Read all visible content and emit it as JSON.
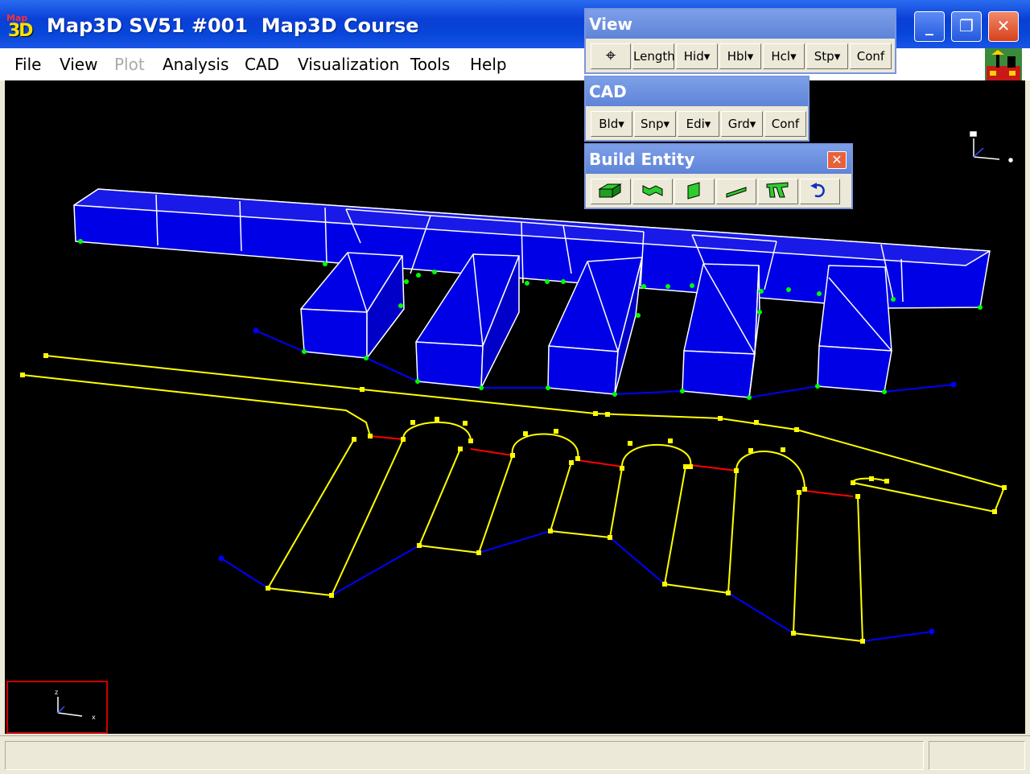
{
  "window": {
    "title": "Map3D SV51 #001  Map3D Course",
    "logo_top": "Map",
    "logo_bottom": "3D",
    "minimize_glyph": "_",
    "restore_glyph": "❐",
    "close_glyph": "✕"
  },
  "menubar": {
    "items": [
      {
        "label": "File",
        "enabled": true
      },
      {
        "label": "View",
        "enabled": true
      },
      {
        "label": "Plot",
        "enabled": false
      },
      {
        "label": "Analysis",
        "enabled": true
      },
      {
        "label": "CAD",
        "enabled": true
      },
      {
        "label": "Visualization",
        "enabled": true
      },
      {
        "label": "Tools",
        "enabled": true
      },
      {
        "label": "Help",
        "enabled": true
      }
    ]
  },
  "palettes": {
    "view": {
      "title": "View",
      "buttons": [
        "⌖",
        "Length",
        "Hid▾",
        "Hbl▾",
        "Hcl▾",
        "Stp▾",
        "Conf"
      ]
    },
    "cad": {
      "title": "CAD",
      "buttons": [
        "Bld▾",
        "Snp▾",
        "Edi▾",
        "Grd▾",
        "Conf"
      ]
    },
    "build_entity": {
      "title": "Build Entity",
      "close_glyph": "✕",
      "icons": [
        "block-icon",
        "surface-icon",
        "plate-icon",
        "line-icon",
        "excavation-icon",
        "undo-icon"
      ]
    }
  },
  "colors": {
    "stope_fill": "#0000ee",
    "stope_edge": "#ffffff",
    "vertex_green": "#00ff00",
    "outline_yellow": "#ffff00",
    "link_red": "#ff0000",
    "path_blue": "#0000ff",
    "background": "#000000"
  }
}
